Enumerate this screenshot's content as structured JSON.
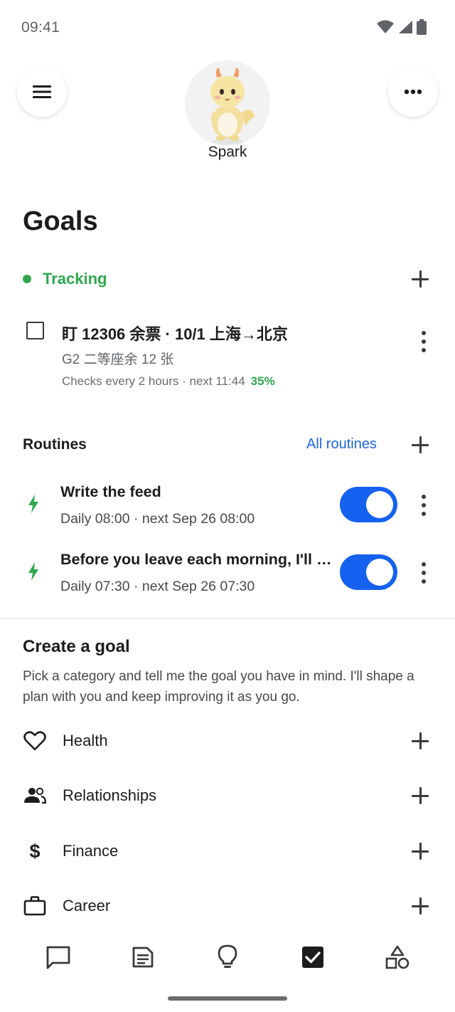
{
  "status_bar": {
    "time": "09:41"
  },
  "header": {
    "avatar_name": "Spark"
  },
  "page_title": "Goals",
  "tracking": {
    "label": "Tracking",
    "color": "#2fa84f",
    "goal": {
      "title": "盯 12306 余票 · 10/1 上海→北京",
      "subtitle": "G2 二等座余 12 张",
      "meta": "Checks every 2 hours · next 11:44",
      "progress": "35%"
    }
  },
  "routines": {
    "title": "Routines",
    "all_link": "All routines",
    "items": [
      {
        "title": "Write the feed",
        "schedule": "Daily 08:00 · next Sep 26 08:00",
        "enabled": true
      },
      {
        "title": "Before you leave each morning, I'll …",
        "schedule": "Daily 07:30 · next Sep 26 07:30",
        "enabled": true
      }
    ]
  },
  "create_goal": {
    "title": "Create a goal",
    "description": "Pick a category and tell me the goal you have in mind. I'll shape a plan with you and keep improving it as you go.",
    "categories": [
      {
        "label": "Health",
        "icon": "heart-icon"
      },
      {
        "label": "Relationships",
        "icon": "people-icon"
      },
      {
        "label": "Finance",
        "icon": "dollar-icon"
      },
      {
        "label": "Career",
        "icon": "briefcase-icon"
      }
    ]
  },
  "bottom_nav": [
    {
      "icon": "chat-icon",
      "active": false
    },
    {
      "icon": "notes-icon",
      "active": false
    },
    {
      "icon": "lightbulb-icon",
      "active": false
    },
    {
      "icon": "goals-check-icon",
      "active": true
    },
    {
      "icon": "shapes-icon",
      "active": false
    }
  ],
  "colors": {
    "accent_blue": "#1462ef",
    "link_blue": "#1a66e0",
    "success_green": "#2fa84f"
  }
}
